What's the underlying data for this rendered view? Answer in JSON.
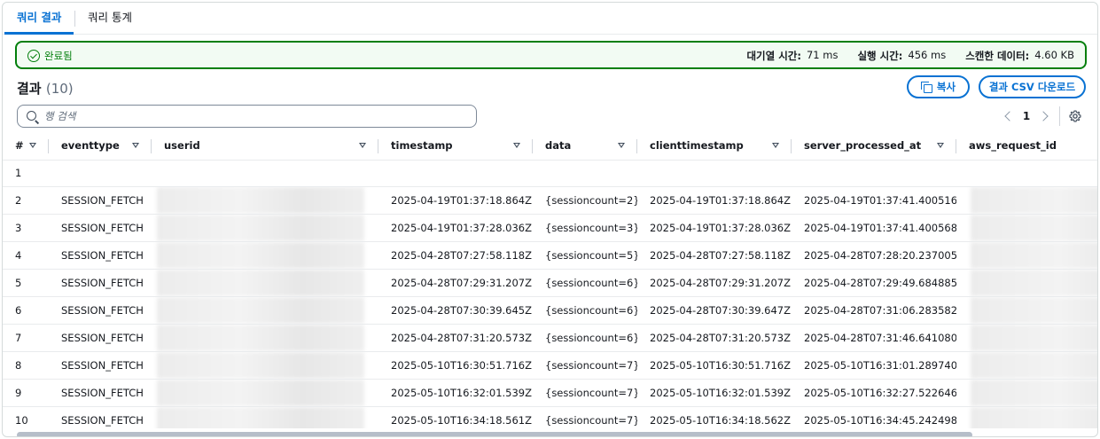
{
  "tabs": [
    {
      "label": "쿼리 결과",
      "active": true
    },
    {
      "label": "쿼리 통계",
      "active": false
    }
  ],
  "status": {
    "state": "완료됨",
    "queue_label": "대기열 시간:",
    "queue_value": "71 ms",
    "run_label": "실행 시간:",
    "run_value": "456 ms",
    "scan_label": "스캔한 데이터:",
    "scan_value": "4.60 KB"
  },
  "results": {
    "title": "결과",
    "count": "(10)",
    "copy_label": "복사",
    "csv_label": "결과 CSV 다운로드",
    "search_placeholder": "행 검색",
    "page": "1"
  },
  "columns": [
    "#",
    "eventtype",
    "userid",
    "timestamp",
    "data",
    "clienttimestamp",
    "server_processed_at",
    "aws_request_id"
  ],
  "rows": [
    {
      "n": "1",
      "eventtype": "",
      "timestamp": "",
      "data": "",
      "clienttimestamp": "",
      "server": ""
    },
    {
      "n": "2",
      "eventtype": "SESSION_FETCH",
      "timestamp": "2025-04-19T01:37:18.864Z",
      "data": "{sessioncount=2}",
      "clienttimestamp": "2025-04-19T01:37:18.864Z",
      "server": "2025-04-19T01:37:41.400516"
    },
    {
      "n": "3",
      "eventtype": "SESSION_FETCH",
      "timestamp": "2025-04-19T01:37:28.036Z",
      "data": "{sessioncount=3}",
      "clienttimestamp": "2025-04-19T01:37:28.036Z",
      "server": "2025-04-19T01:37:41.400568"
    },
    {
      "n": "4",
      "eventtype": "SESSION_FETCH",
      "timestamp": "2025-04-28T07:27:58.118Z",
      "data": "{sessioncount=5}",
      "clienttimestamp": "2025-04-28T07:27:58.118Z",
      "server": "2025-04-28T07:28:20.237005"
    },
    {
      "n": "5",
      "eventtype": "SESSION_FETCH",
      "timestamp": "2025-04-28T07:29:31.207Z",
      "data": "{sessioncount=6}",
      "clienttimestamp": "2025-04-28T07:29:31.207Z",
      "server": "2025-04-28T07:29:49.684885"
    },
    {
      "n": "6",
      "eventtype": "SESSION_FETCH",
      "timestamp": "2025-04-28T07:30:39.645Z",
      "data": "{sessioncount=6}",
      "clienttimestamp": "2025-04-28T07:30:39.647Z",
      "server": "2025-04-28T07:31:06.283582"
    },
    {
      "n": "7",
      "eventtype": "SESSION_FETCH",
      "timestamp": "2025-04-28T07:31:20.573Z",
      "data": "{sessioncount=6}",
      "clienttimestamp": "2025-04-28T07:31:20.573Z",
      "server": "2025-04-28T07:31:46.641080"
    },
    {
      "n": "8",
      "eventtype": "SESSION_FETCH",
      "timestamp": "2025-05-10T16:30:51.716Z",
      "data": "{sessioncount=7}",
      "clienttimestamp": "2025-05-10T16:30:51.716Z",
      "server": "2025-05-10T16:31:01.289740"
    },
    {
      "n": "9",
      "eventtype": "SESSION_FETCH",
      "timestamp": "2025-05-10T16:32:01.539Z",
      "data": "{sessioncount=7}",
      "clienttimestamp": "2025-05-10T16:32:01.539Z",
      "server": "2025-05-10T16:32:27.522646"
    },
    {
      "n": "10",
      "eventtype": "SESSION_FETCH",
      "timestamp": "2025-05-10T16:34:18.561Z",
      "data": "{sessioncount=7}",
      "clienttimestamp": "2025-05-10T16:34:18.562Z",
      "server": "2025-05-10T16:34:45.242498"
    }
  ],
  "colors": {
    "accent": "#0972d3",
    "success": "#037f0c",
    "success_bg": "#f2fbf3"
  }
}
